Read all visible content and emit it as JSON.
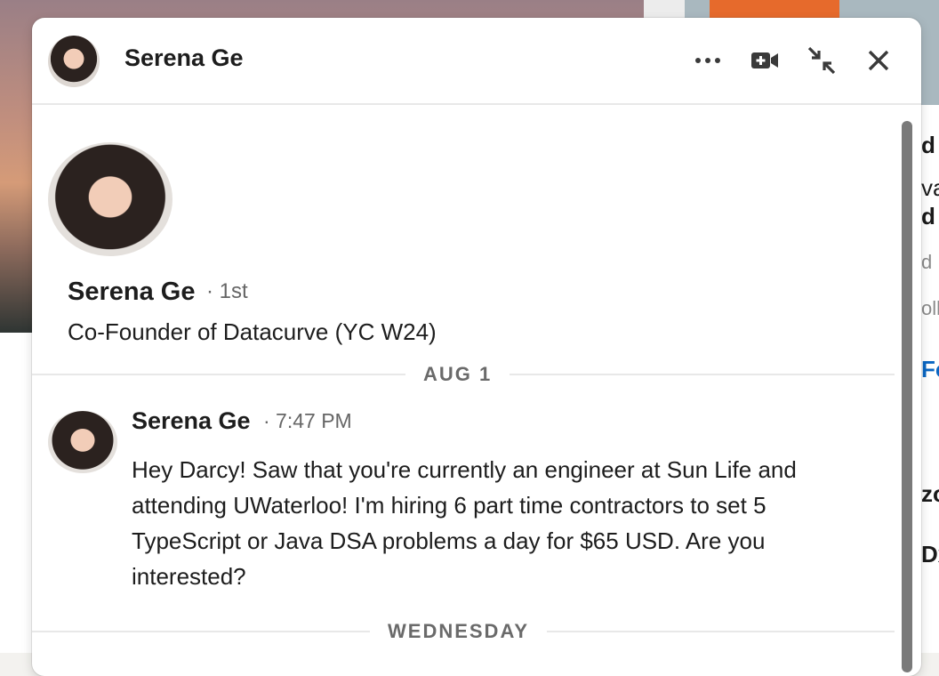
{
  "chat": {
    "header": {
      "name": "Serena Ge",
      "icons": [
        "more-icon",
        "video-call-icon",
        "minimize-icon",
        "close-icon"
      ]
    },
    "profile": {
      "name": "Serena Ge",
      "degree": "· 1st",
      "headline": "Co-Founder of Datacurve (YC W24)"
    },
    "dividers": [
      "AUG 1",
      "WEDNESDAY"
    ],
    "messages": [
      {
        "sender": "Serena Ge",
        "time": "· 7:47 PM",
        "text": "Hey Darcy! Saw that you're currently an engineer at Sun Life and attending UWaterloo! I'm hiring 6 part time contractors to set 5 TypeScript or Java DSA problems a day for $65 USD. Are you interested?"
      }
    ]
  },
  "background": {
    "peek_texts": [
      "d",
      "va",
      "d",
      "d",
      "olle",
      "Fo",
      "zo",
      "Dx"
    ]
  },
  "colors": {
    "accent_blue": "#0a66c2",
    "orange": "#e66a2c"
  }
}
